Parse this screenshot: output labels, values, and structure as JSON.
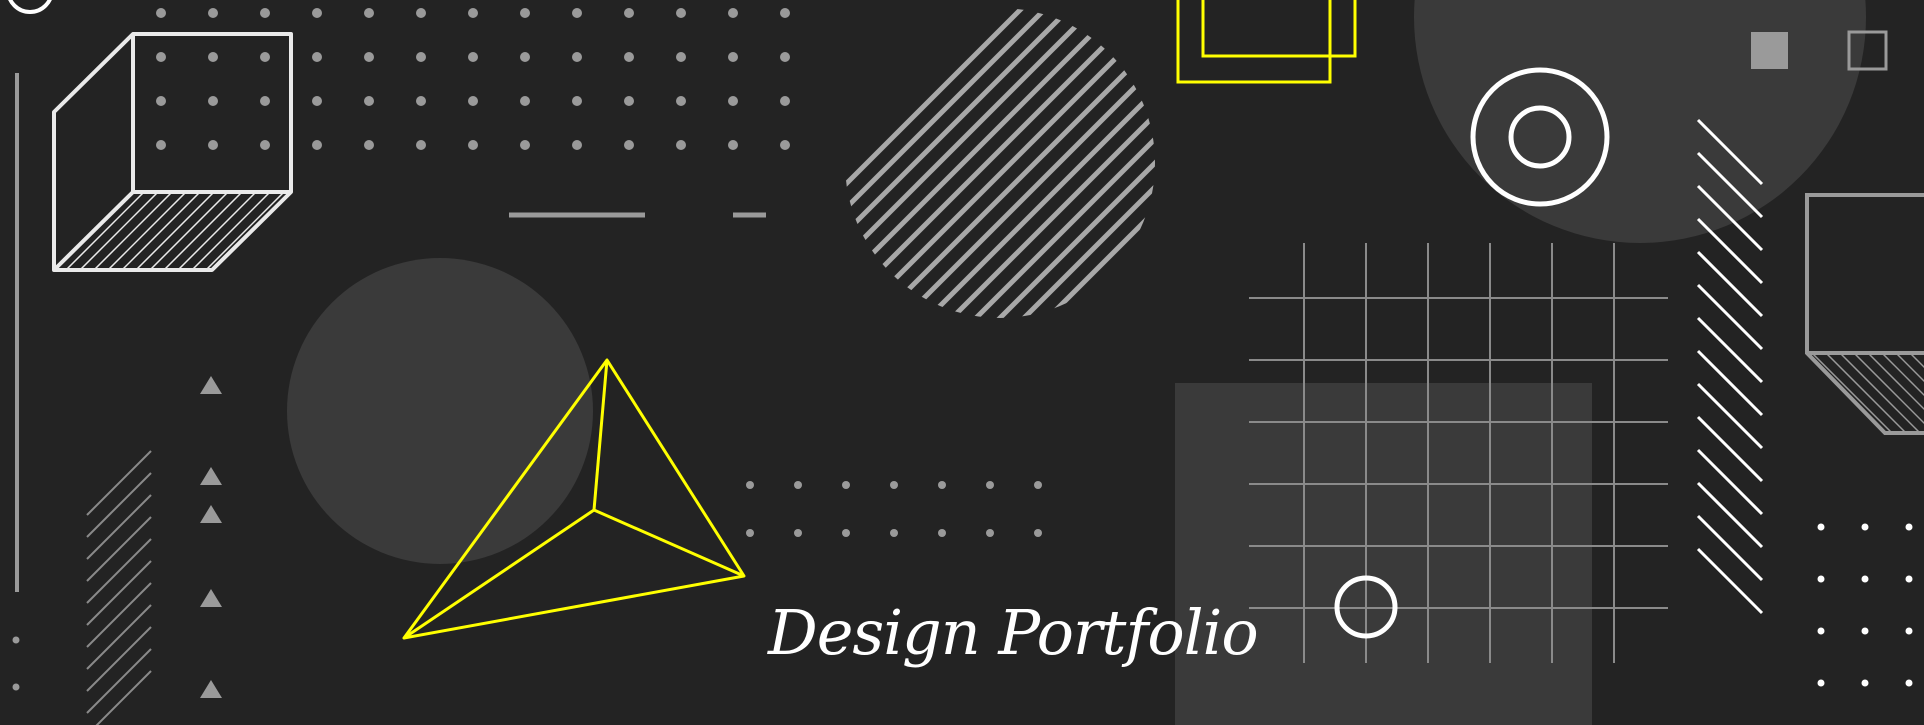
{
  "title": "Design Portfolio",
  "colors": {
    "background": "#232323",
    "accent_yellow": "#ffff00",
    "white": "#ffffff",
    "gray": "#9a9a9a",
    "dark_shape": "#3a3a3a"
  },
  "icons": [
    "isometric-cube-outline",
    "dot-grid-pattern",
    "hatched-circle",
    "overlapping-yellow-squares",
    "concentric-circles",
    "grid-lines-pattern",
    "yellow-wireframe-pyramid",
    "triangle-markers",
    "diagonal-hatch-lines",
    "small-ring",
    "filled-square",
    "outlined-square"
  ]
}
